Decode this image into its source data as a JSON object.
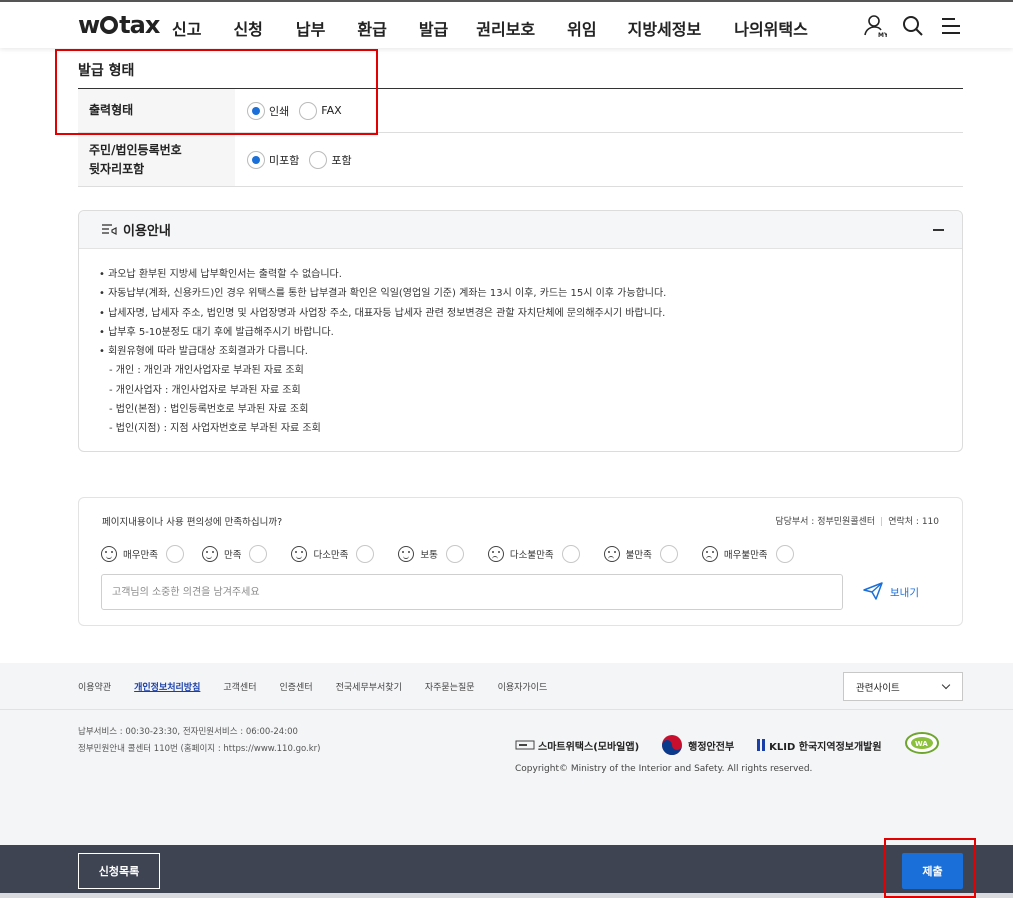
{
  "header": {
    "logo": "wetax",
    "nav": [
      "신고",
      "신청",
      "납부",
      "환급",
      "발급",
      "권리보호",
      "위임",
      "지방세정보",
      "나의위택스"
    ],
    "icons": [
      "my-user-icon",
      "search-icon",
      "menu-icon"
    ]
  },
  "issue_form": {
    "section_title": "발급 형태",
    "output_type": {
      "label": "출력형태",
      "options": [
        "인쇄",
        "FAX"
      ],
      "selected": "인쇄"
    },
    "resident_number": {
      "label_line1": "주민/법인등록번호",
      "label_line2": "뒷자리포함",
      "options": [
        "미포함",
        "포함"
      ],
      "selected": "미포함"
    }
  },
  "guide": {
    "title": "이용안내",
    "items": [
      "• 과오납 환부된 지방세 납부확인서는 출력할 수 없습니다.",
      "• 자동납부(계좌, 신용카드)인 경우 위택스를 통한 납부결과 확인은 익일(영업일 기준) 계좌는 13시 이후, 카드는 15시 이후 가능합니다.",
      "• 납세자명, 납세자 주소, 법인명 및 사업장명과 사업장 주소, 대표자등 납세자 관련 정보변경은 관할 자치단체에 문의해주시기 바랍니다.",
      "• 납부후 5-10분정도 대기 후에 발급해주시기 바랍니다.",
      "• 회원유형에 따라 발급대상 조회결과가 다릅니다."
    ],
    "sub_items": [
      "- 개인 : 개인과 개인사업자로 부과된 자료 조회",
      "- 개인사업자 : 개인사업자로 부과된 자료 조회",
      "- 법인(본점) : 법인등록번호로 부과된 자료 조회",
      "- 법인(지점) : 지점 사업자번호로 부과된 자료 조회"
    ]
  },
  "survey": {
    "question": "페이지내용이나 사용 편의성에 만족하십니까?",
    "dept": "담당부서 : 정부민원콜센터",
    "contact": "연락처 : 110",
    "ratings": [
      "매우만족",
      "만족",
      "다소만족",
      "보통",
      "다소불만족",
      "불만족",
      "매우불만족"
    ],
    "placeholder": "고객님의 소중한 의견을 남겨주세요",
    "send_label": "보내기"
  },
  "footer": {
    "links": [
      "이용약관",
      "개인정보처리방침",
      "고객센터",
      "인증센터",
      "전국세무부서찾기",
      "자주묻는질문",
      "이용자가이드"
    ],
    "related_label": "관련사이트",
    "info_line1": "납부서비스 : 00:30-23:30, 전자민원서비스 : 06:00-24:00",
    "info_line2": "정부민원안내 콜센터 110번 (홈페이지 : https://www.110.go.kr)",
    "partners": [
      "스마트위택스(모바일앱)",
      "행정안전부",
      "KLID 한국지역정보개발원"
    ],
    "copyright": "Copyright© Ministry of the Interior and Safety. All rights reserved."
  },
  "bottom_bar": {
    "list_label": "신청목록",
    "submit_label": "제출"
  },
  "colors": {
    "accent": "#1a6fd8",
    "highlight_box": "#e30000",
    "bottom_bar": "#3f4453"
  }
}
